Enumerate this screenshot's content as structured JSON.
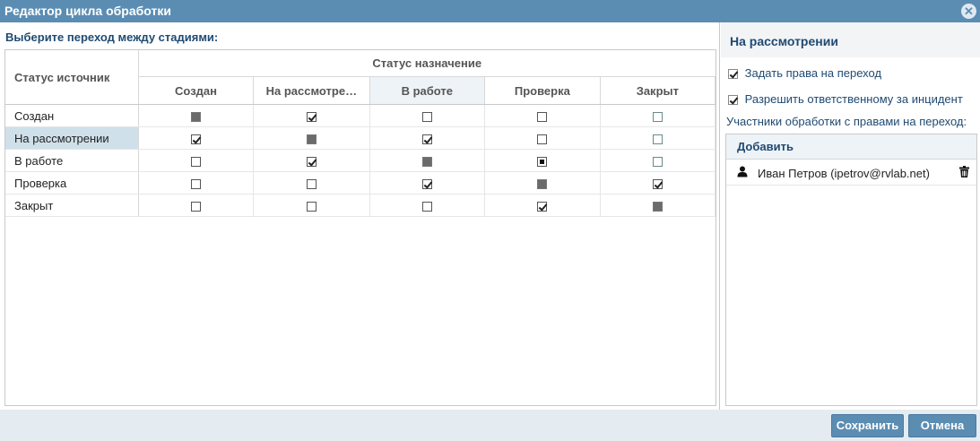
{
  "window": {
    "title": "Редактор цикла обработки"
  },
  "left": {
    "heading": "Выберите переход между стадиями:",
    "source_header": "Статус источник",
    "dest_header": "Статус назначение",
    "columns": [
      "Создан",
      "На рассмотре…",
      "В работе",
      "Проверка",
      "Закрыт"
    ],
    "rows": [
      {
        "label": "Создан",
        "cells": [
          "disabled",
          "checked",
          "unchecked",
          "unchecked",
          "unchecked"
        ]
      },
      {
        "label": "На рассмотрении",
        "cells": [
          "checked",
          "disabled",
          "checked",
          "unchecked",
          "unchecked"
        ]
      },
      {
        "label": "В работе",
        "cells": [
          "unchecked",
          "checked",
          "disabled",
          "indeterminate",
          "unchecked"
        ]
      },
      {
        "label": "Проверка",
        "cells": [
          "unchecked",
          "unchecked",
          "checked",
          "disabled",
          "checked"
        ]
      },
      {
        "label": "Закрыт",
        "cells": [
          "unchecked",
          "unchecked",
          "unchecked",
          "checked",
          "disabled"
        ]
      }
    ],
    "selected_row": 1,
    "active_column": 2
  },
  "right": {
    "title": "На рассмотрении",
    "option_rights": "Задать права на переход",
    "option_responsible": "Разрешить ответственному за инцидент",
    "participants_label": "Участники обработки с правами на переход:",
    "add_label": "Добавить",
    "members": [
      "Иван Петров (ipetrov@rvlab.net)"
    ]
  },
  "footer": {
    "save_label": "Сохранить",
    "cancel_label": "Отмена"
  },
  "colors": {
    "accent": "#5b8db3",
    "heading_text": "#1f4a72",
    "selected_row": "#cfe0ea"
  }
}
